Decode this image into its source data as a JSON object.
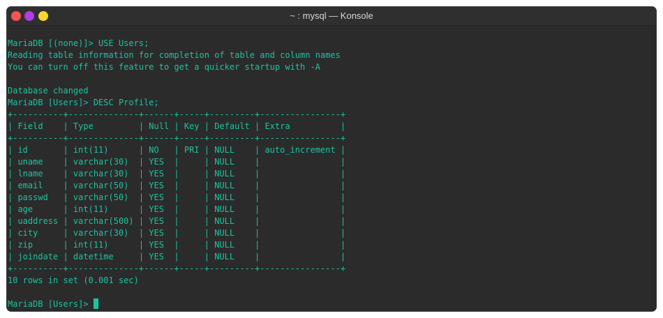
{
  "window": {
    "title": "~ : mysql — Konsole"
  },
  "colors": {
    "background": "#2b2b2b",
    "text": "#1ec39f",
    "close": "#f4554f",
    "minimize": "#b43be6",
    "maximize": "#f9d52f"
  },
  "terminal": {
    "lines": [
      "",
      "MariaDB [(none)]> USE Users;",
      "Reading table information for completion of table and column names",
      "You can turn off this feature to get a quicker startup with -A",
      "",
      "Database changed",
      "MariaDB [Users]> DESC Profile;",
      "+----------+--------------+------+-----+---------+----------------+",
      "| Field    | Type         | Null | Key | Default | Extra          |",
      "+----------+--------------+------+-----+---------+----------------+",
      "| id       | int(11)      | NO   | PRI | NULL    | auto_increment |",
      "| uname    | varchar(30)  | YES  |     | NULL    |                |",
      "| lname    | varchar(30)  | YES  |     | NULL    |                |",
      "| email    | varchar(50)  | YES  |     | NULL    |                |",
      "| passwd   | varchar(50)  | YES  |     | NULL    |                |",
      "| age      | int(11)      | YES  |     | NULL    |                |",
      "| uaddress | varchar(500) | YES  |     | NULL    |                |",
      "| city     | varchar(30)  | YES  |     | NULL    |                |",
      "| zip      | int(11)      | YES  |     | NULL    |                |",
      "| joindate | datetime     | YES  |     | NULL    |                |",
      "+----------+--------------+------+-----+---------+----------------+",
      "10 rows in set (0.001 sec)",
      "",
      "MariaDB [Users]>"
    ]
  }
}
